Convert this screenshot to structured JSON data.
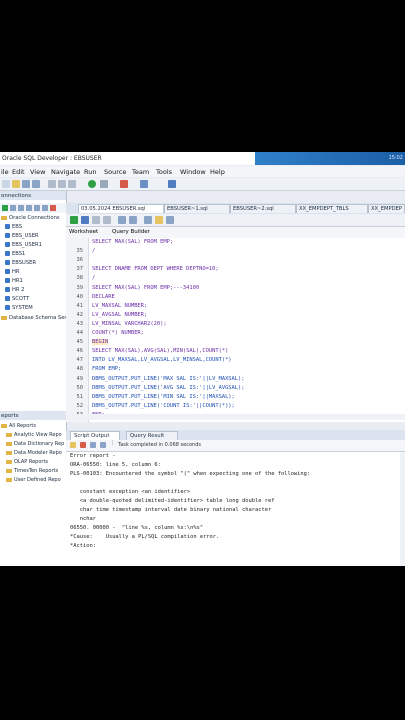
{
  "window": {
    "title": "Oracle SQL Developer : EBSUSER",
    "clock": "15:02"
  },
  "menu": [
    "ile",
    "Edit",
    "View",
    "Navigate",
    "Run",
    "Source",
    "Team",
    "Tools",
    "Window",
    "Help"
  ],
  "connections_panel": {
    "title": "onnections",
    "items": [
      "EBS",
      "EBS_USER",
      "EBS_USER1",
      "EBS1",
      "EBSUSER",
      "HR",
      "HR1",
      "HR 2",
      "SCOTT",
      "SYSTEM"
    ],
    "root": "Oracle Connections",
    "footer": "Database Schema Servi"
  },
  "reports_panel": {
    "title": "eports",
    "items": [
      "All Reports",
      "Analytic View Repo",
      "Data Dictionary Rep",
      "Data Modeler Repo",
      "OLAP Reports",
      "TimesTen Reports",
      "User Defined Repo"
    ]
  },
  "editor_tabs": [
    "03.05.2024 EBSUSER.sql",
    "EBSUSER~1.sql",
    "EBSUSER~2.sql",
    "XX_EMPDEPT_TBLS",
    "XX_EMPDEP"
  ],
  "worksheet_tabs": {
    "worksheet": "Worksheet",
    "query_builder": "Query Builder"
  },
  "editor_lines": [
    {
      "n": "",
      "text": "SELECT MAX(SAL) FROM EMP;"
    },
    {
      "n": "35",
      "text": "/"
    },
    {
      "n": "36",
      "text": ""
    },
    {
      "n": "37",
      "text": "SELECT DNAME FROM DEPT WHERE DEPTNO=10;"
    },
    {
      "n": "38",
      "text": "/"
    },
    {
      "n": "39",
      "text": "SELECT MAX(SAL) FROM EMP;---34100"
    },
    {
      "n": "40",
      "text": "DECLARE"
    },
    {
      "n": "41",
      "text": "LV_MAXSAL NUMBER;"
    },
    {
      "n": "42",
      "text": "LV_AVGSAL NUMBER;"
    },
    {
      "n": "43",
      "text": "LV_MINSAL VARCHAR2(20);"
    },
    {
      "n": "44",
      "text": "COUNT(*) NUMBER;"
    },
    {
      "n": "45",
      "text": "BEGIN"
    },
    {
      "n": "46",
      "text": "SELECT MAX(SAL),AVG(SAL),MIN(SAL),COUNT(*)"
    },
    {
      "n": "47",
      "text": "INTO LV_MAXSAL,LV_AVGSAL,LV_MINSAL,COUNT(*)"
    },
    {
      "n": "48",
      "text": "FROM EMP;"
    },
    {
      "n": "49",
      "text": "DBMS_OUTPUT.PUT_LINE('MAX SAL IS:'||LV_MAXSAL);"
    },
    {
      "n": "50",
      "text": "DBMS_OUTPUT.PUT_LINE('AVG SAL IS:'||LV_AVGSAL);"
    },
    {
      "n": "51",
      "text": "DBMS_OUTPUT.PUT_LINE('MIN SAL IS:'||MAXSAL);"
    },
    {
      "n": "52",
      "text": "DBMS_OUTPUT.PUT_LINE('COUNT IS:'||COUNT(*));"
    },
    {
      "n": "53",
      "text": "END;"
    }
  ],
  "output_tabs": {
    "script_output": "Script Output",
    "query_result": "Query Result"
  },
  "output_status": "Task completed in 0.068 seconds",
  "output_lines": [
    "Error report -",
    "ORA-06550: line 5, column 6:",
    "PLS-00103: Encountered the symbol \"(\" when expecting one of the following:",
    "",
    "   constant exception <an identifier>",
    "   <a double-quoted delimited-identifier> table long double ref",
    "   char time timestamp interval date binary national character",
    "   nchar",
    "06550. 00000 -  \"line %s, column %s:\\n%s\"",
    "*Cause:    Usually a PL/SQL compilation error.",
    "*Action:"
  ]
}
